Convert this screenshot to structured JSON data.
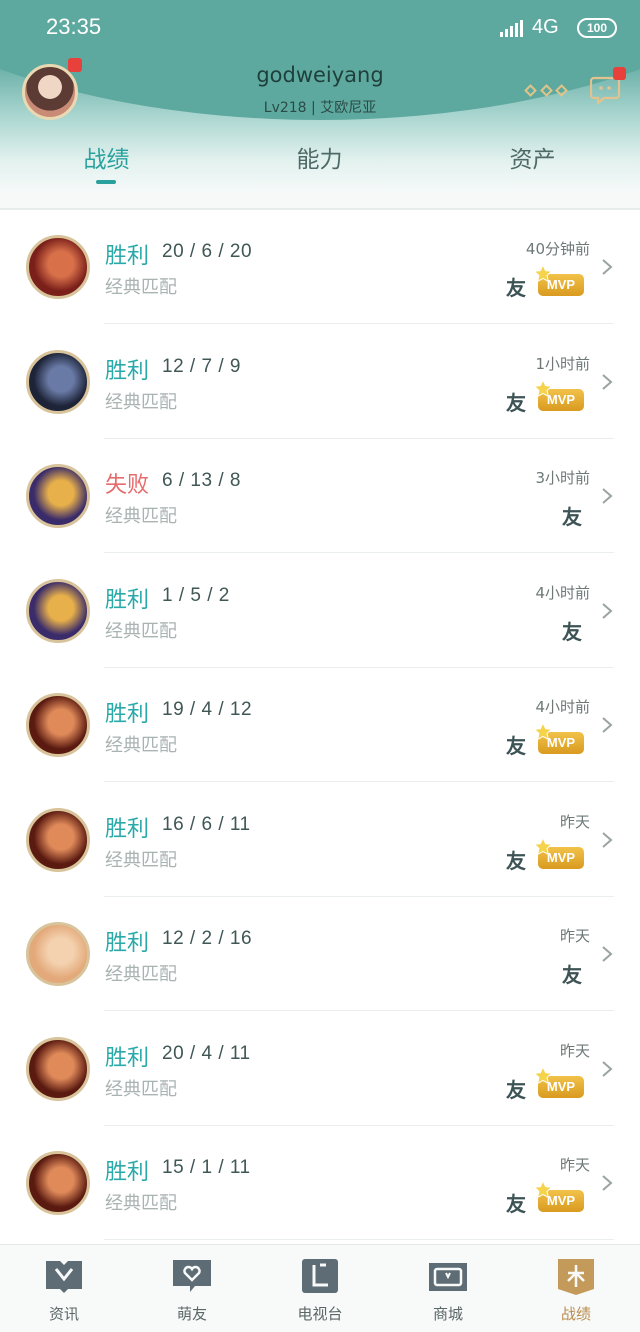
{
  "status_bar": {
    "time": "23:35",
    "network": "4G",
    "battery": "100"
  },
  "profile": {
    "username": "godweiyang",
    "info": "Lv218 | 艾欧尼亚"
  },
  "tabs": [
    {
      "label": "战绩",
      "active": true
    },
    {
      "label": "能力",
      "active": false
    },
    {
      "label": "资产",
      "active": false
    }
  ],
  "matches": [
    {
      "result": "胜利",
      "win": true,
      "kda": "20 / 6 / 20",
      "mode": "经典匹配",
      "time": "40分钟前",
      "friend": "友",
      "mvp": true,
      "champ_colors": [
        "#7a1f1a",
        "#d8704a"
      ]
    },
    {
      "result": "胜利",
      "win": true,
      "kda": "12 / 7 / 9",
      "mode": "经典匹配",
      "time": "1小时前",
      "friend": "友",
      "mvp": true,
      "champ_colors": [
        "#1d2438",
        "#6a7aa6"
      ]
    },
    {
      "result": "失败",
      "win": false,
      "kda": "6 / 13 / 8",
      "mode": "经典匹配",
      "time": "3小时前",
      "friend": "友",
      "mvp": false,
      "champ_colors": [
        "#3a2b6a",
        "#e7b04a"
      ]
    },
    {
      "result": "胜利",
      "win": true,
      "kda": "1 / 5 / 2",
      "mode": "经典匹配",
      "time": "4小时前",
      "friend": "友",
      "mvp": false,
      "champ_colors": [
        "#3a2b6a",
        "#e7b04a"
      ]
    },
    {
      "result": "胜利",
      "win": true,
      "kda": "19 / 4 / 12",
      "mode": "经典匹配",
      "time": "4小时前",
      "friend": "友",
      "mvp": true,
      "champ_colors": [
        "#5a1a10",
        "#e08a5a"
      ]
    },
    {
      "result": "胜利",
      "win": true,
      "kda": "16 / 6 / 11",
      "mode": "经典匹配",
      "time": "昨天",
      "friend": "友",
      "mvp": true,
      "champ_colors": [
        "#5a1a10",
        "#e08a5a"
      ]
    },
    {
      "result": "胜利",
      "win": true,
      "kda": "12 / 2 / 16",
      "mode": "经典匹配",
      "time": "昨天",
      "friend": "友",
      "mvp": false,
      "champ_colors": [
        "#e3a97a",
        "#f4d2b0"
      ]
    },
    {
      "result": "胜利",
      "win": true,
      "kda": "20 / 4 / 11",
      "mode": "经典匹配",
      "time": "昨天",
      "friend": "友",
      "mvp": true,
      "champ_colors": [
        "#5a1a10",
        "#e08a5a"
      ]
    },
    {
      "result": "胜利",
      "win": true,
      "kda": "15 / 1 / 11",
      "mode": "经典匹配",
      "time": "昨天",
      "friend": "友",
      "mvp": true,
      "champ_colors": [
        "#5a1a10",
        "#e08a5a"
      ]
    }
  ],
  "mvp_label": "MVP",
  "bottom_nav": [
    {
      "label": "资讯",
      "icon": "news-icon",
      "active": false
    },
    {
      "label": "萌友",
      "icon": "friends-icon",
      "active": false
    },
    {
      "label": "电视台",
      "icon": "tv-icon",
      "active": false
    },
    {
      "label": "商城",
      "icon": "store-icon",
      "active": false
    },
    {
      "label": "战绩",
      "icon": "record-icon",
      "active": true
    }
  ],
  "colors": {
    "accent": "#2aa19d",
    "win": "#2aa9a9",
    "loss": "#e76b6b",
    "mvp_gold": "#e3a934",
    "header_teal": "#5ea99f"
  }
}
